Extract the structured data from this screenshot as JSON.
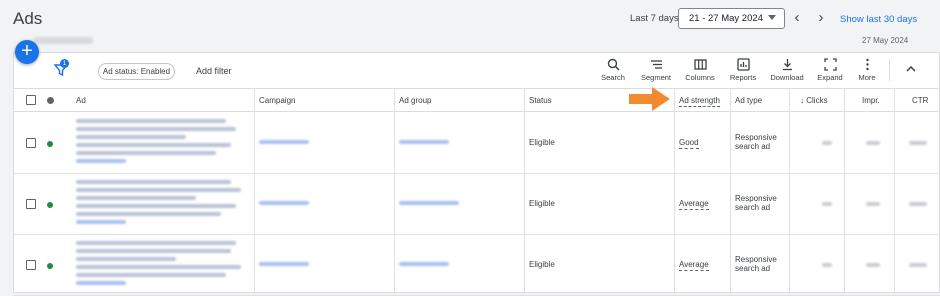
{
  "page": {
    "title": "Ads",
    "date_label": "Last 7 days",
    "date_range": "21 - 27 May 2024",
    "show_last": "Show last 30 days",
    "end_date": "27 May 2024"
  },
  "toolbar": {
    "filter_badge": "1",
    "chip": "Ad status: Enabled",
    "add_filter": "Add filter",
    "tools": [
      "Search",
      "Segment",
      "Columns",
      "Reports",
      "Download",
      "Expand",
      "More"
    ]
  },
  "table": {
    "headers": {
      "ad": "Ad",
      "campaign": "Campaign",
      "ad_group": "Ad group",
      "status": "Status",
      "ad_strength": "Ad strength",
      "ad_type": "Ad type",
      "clicks": "Clicks",
      "impr": "Impr.",
      "ctr": "CTR"
    },
    "sort_icon": "arrow-down-icon",
    "rows": [
      {
        "status": "Eligible",
        "ad_strength": "Good",
        "ad_type_1": "Responsive",
        "ad_type_2": "search ad"
      },
      {
        "status": "Eligible",
        "ad_strength": "Average",
        "ad_type_1": "Responsive",
        "ad_type_2": "search ad"
      },
      {
        "status": "Eligible",
        "ad_strength": "Average",
        "ad_type_1": "Responsive",
        "ad_type_2": "search ad"
      }
    ]
  },
  "colors": {
    "accent": "#1a73e8",
    "enabled_dot": "#1e8e3e",
    "highlight_arrow": "#f28b30"
  }
}
